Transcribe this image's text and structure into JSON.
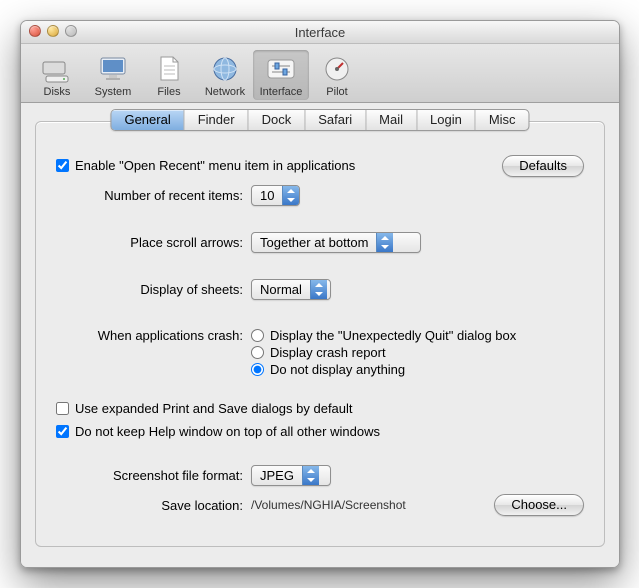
{
  "window": {
    "title": "Interface"
  },
  "toolbar": {
    "items": [
      {
        "label": "Disks"
      },
      {
        "label": "System"
      },
      {
        "label": "Files"
      },
      {
        "label": "Network"
      },
      {
        "label": "Interface"
      },
      {
        "label": "Pilot"
      }
    ],
    "selected": 4
  },
  "tabs": [
    "General",
    "Finder",
    "Dock",
    "Safari",
    "Mail",
    "Login",
    "Misc"
  ],
  "active_tab": 0,
  "general": {
    "enable_open_recent_label": "Enable \"Open Recent\" menu item in applications",
    "enable_open_recent_checked": true,
    "defaults_button": "Defaults",
    "recent_items_label": "Number of recent items:",
    "recent_items_value": "10",
    "scroll_arrows_label": "Place scroll arrows:",
    "scroll_arrows_value": "Together at bottom",
    "sheets_label": "Display of sheets:",
    "sheets_value": "Normal",
    "crash_label": "When applications crash:",
    "crash_options": [
      "Display the \"Unexpectedly Quit\" dialog box",
      "Display crash report",
      "Do not display anything"
    ],
    "crash_selected": 2,
    "expanded_dialogs_label": "Use expanded Print and Save dialogs by default",
    "expanded_dialogs_checked": false,
    "help_window_label": "Do not keep Help window on top of all other windows",
    "help_window_checked": true,
    "screenshot_format_label": "Screenshot file format:",
    "screenshot_format_value": "JPEG",
    "save_location_label": "Save location:",
    "save_location_value": "/Volumes/NGHIA/Screenshot",
    "choose_button": "Choose..."
  }
}
